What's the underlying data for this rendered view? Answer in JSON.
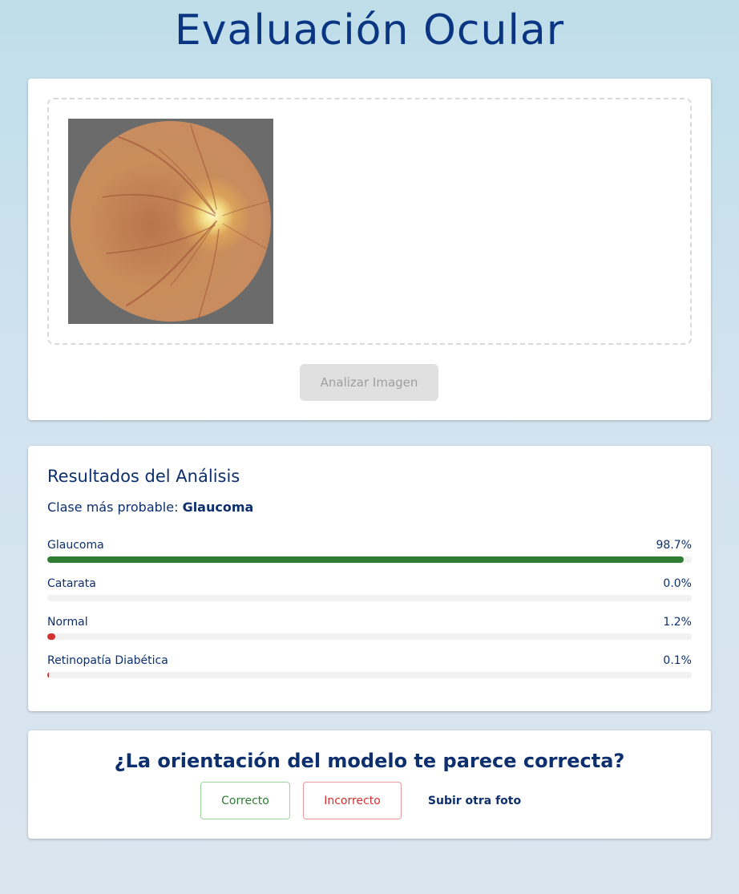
{
  "header": {
    "title": "Evaluación Ocular"
  },
  "upload": {
    "image_alt": "Retinal fundus photograph",
    "analyze_label": "Analizar Imagen"
  },
  "results": {
    "title": "Resultados del Análisis",
    "top_class_prefix": "Clase más probable:",
    "top_class": "Glaucoma",
    "items": [
      {
        "label": "Glaucoma",
        "value_text": "98.7%",
        "percent": 98.7,
        "color": "#2e7d32"
      },
      {
        "label": "Catarata",
        "value_text": "0.0%",
        "percent": 0.0,
        "color": "#d32f2f"
      },
      {
        "label": "Normal",
        "value_text": "1.2%",
        "percent": 1.2,
        "color": "#d32f2f"
      },
      {
        "label": "Retinopatía Diabética",
        "value_text": "0.1%",
        "percent": 0.1,
        "color": "#d32f2f"
      }
    ]
  },
  "feedback": {
    "question": "¿La orientación del modelo te parece correcta?",
    "correct_label": "Correcto",
    "incorrect_label": "Incorrecto",
    "upload_again_label": "Subir otra foto"
  },
  "colors": {
    "title": "#0a3582",
    "text": "#0d2f6e",
    "success": "#2e7d32",
    "danger": "#d32f2f",
    "disabled_bg": "#e0e0e0"
  }
}
